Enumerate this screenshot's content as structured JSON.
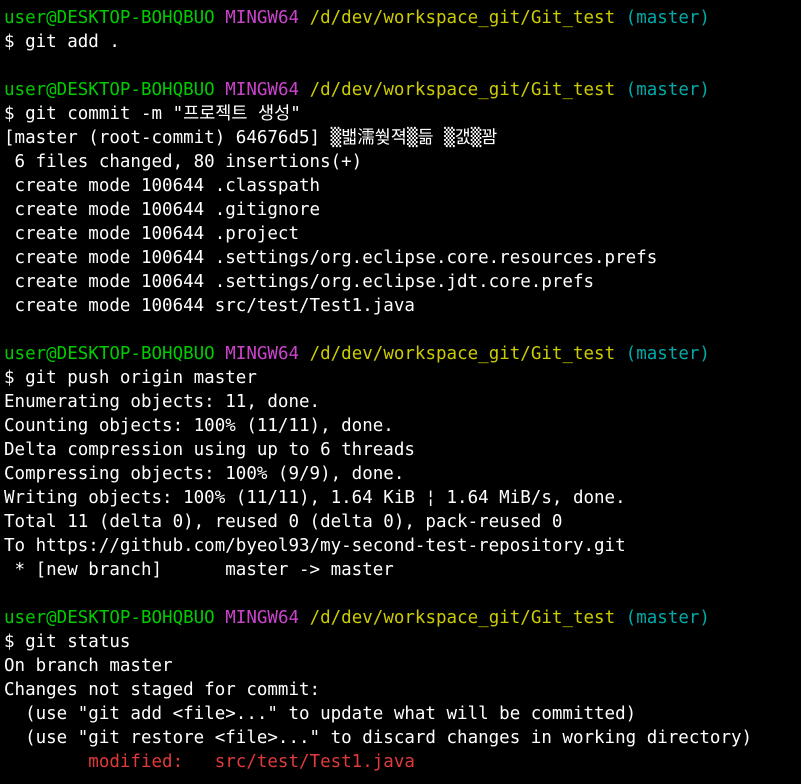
{
  "colors": {
    "background": "#000000",
    "user": "#00cc00",
    "host": "#cc44cc",
    "path": "#cccc00",
    "branch": "#00aaaa",
    "default": "#ffffff",
    "modified": "#e03a3a"
  },
  "lines": [
    {
      "type": "prompt",
      "user": "user@DESKTOP-BOHQBUO",
      "host": "MINGW64",
      "path": "/d/dev/workspace_git/Git_test",
      "branch": "(master)"
    },
    {
      "type": "text",
      "text": "$ git add ."
    },
    {
      "type": "blank"
    },
    {
      "type": "prompt",
      "user": "user@DESKTOP-BOHQBUO",
      "host": "MINGW64",
      "path": "/d/dev/workspace_git/Git_test",
      "branch": "(master)"
    },
    {
      "type": "text",
      "text": "$ git commit -m \"프로젝트 생성\""
    },
    {
      "type": "text",
      "text": "[master (root-commit) 64676d5] ▒밻濡쒖젹▒듦 ▒갨▒꽘"
    },
    {
      "type": "text",
      "text": " 6 files changed, 80 insertions(+)"
    },
    {
      "type": "text",
      "text": " create mode 100644 .classpath"
    },
    {
      "type": "text",
      "text": " create mode 100644 .gitignore"
    },
    {
      "type": "text",
      "text": " create mode 100644 .project"
    },
    {
      "type": "text",
      "text": " create mode 100644 .settings/org.eclipse.core.resources.prefs"
    },
    {
      "type": "text",
      "text": " create mode 100644 .settings/org.eclipse.jdt.core.prefs"
    },
    {
      "type": "text",
      "text": " create mode 100644 src/test/Test1.java"
    },
    {
      "type": "blank"
    },
    {
      "type": "prompt",
      "user": "user@DESKTOP-BOHQBUO",
      "host": "MINGW64",
      "path": "/d/dev/workspace_git/Git_test",
      "branch": "(master)"
    },
    {
      "type": "text",
      "text": "$ git push origin master"
    },
    {
      "type": "text",
      "text": "Enumerating objects: 11, done."
    },
    {
      "type": "text",
      "text": "Counting objects: 100% (11/11), done."
    },
    {
      "type": "text",
      "text": "Delta compression using up to 6 threads"
    },
    {
      "type": "text",
      "text": "Compressing objects: 100% (9/9), done."
    },
    {
      "type": "text",
      "text": "Writing objects: 100% (11/11), 1.64 KiB ¦ 1.64 MiB/s, done."
    },
    {
      "type": "text",
      "text": "Total 11 (delta 0), reused 0 (delta 0), pack-reused 0"
    },
    {
      "type": "text",
      "text": "To https://github.com/byeol93/my-second-test-repository.git"
    },
    {
      "type": "text",
      "text": " * [new branch]      master -> master"
    },
    {
      "type": "blank"
    },
    {
      "type": "prompt",
      "user": "user@DESKTOP-BOHQBUO",
      "host": "MINGW64",
      "path": "/d/dev/workspace_git/Git_test",
      "branch": "(master)"
    },
    {
      "type": "text",
      "text": "$ git status"
    },
    {
      "type": "text",
      "text": "On branch master"
    },
    {
      "type": "text",
      "text": "Changes not staged for commit:"
    },
    {
      "type": "text",
      "text": "  (use \"git add <file>...\" to update what will be committed)"
    },
    {
      "type": "text",
      "text": "  (use \"git restore <file>...\" to discard changes in working directory)"
    },
    {
      "type": "modified",
      "label": "        modified:   ",
      "file": "src/test/Test1.java"
    }
  ]
}
